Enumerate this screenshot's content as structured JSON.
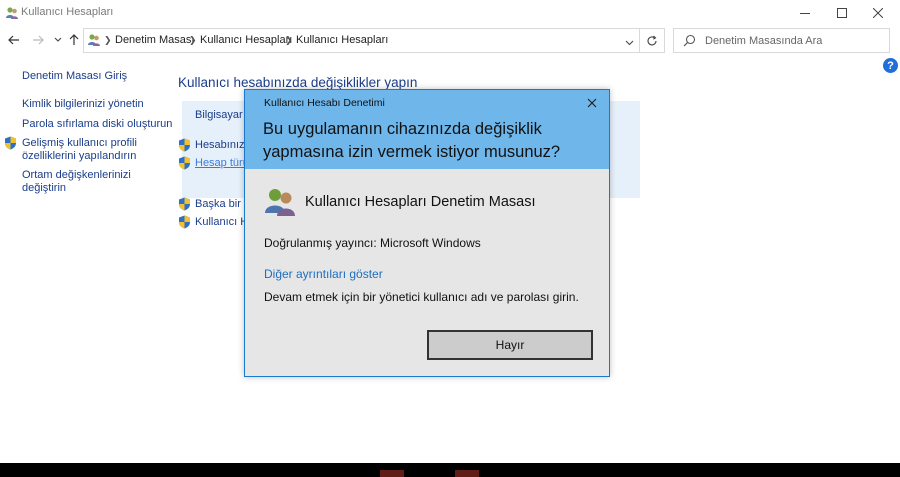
{
  "window": {
    "title": "Kullanıcı Hesapları"
  },
  "address": {
    "crumbs": [
      "Denetim Masası",
      "Kullanıcı Hesapları",
      "Kullanıcı Hesapları"
    ]
  },
  "search": {
    "placeholder": "Denetim Masasında Ara"
  },
  "help_label": "?",
  "left_pane": {
    "home": "Denetim Masası Giriş",
    "items": [
      "Kimlik bilgilerinizi yönetin",
      "Parola sıfırlama diski oluşturun",
      "Gelişmiş kullanıcı profili özelliklerini yapılandırın",
      "Ortam değişkenlerinizi değiştirin"
    ]
  },
  "main": {
    "heading": "Kullanıcı hesabınızda değişiklikler yapın",
    "links": [
      "Bilgisayar a",
      "Hesabınızın",
      "Hesap türün",
      "Başka bir he",
      "Kullanıcı He"
    ]
  },
  "uac": {
    "title": "Kullanıcı Hesabı Denetimi",
    "question": "Bu uygulamanın cihazınızda değişiklik yapmasına izin vermek istiyor musunuz?",
    "app_name": "Kullanıcı Hesapları Denetim Masası",
    "publisher": "Doğrulanmış yayıncı: Microsoft Windows",
    "details_link": "Diğer ayrıntıları göster",
    "message": "Devam etmek için bir yönetici kullanıcı adı ve parolası girin.",
    "no_button": "Hayır"
  },
  "colors": {
    "link": "#1a3d8a",
    "uac_header": "#6fb6ea",
    "uac_body": "#e6e6e6",
    "uac_link": "#1b6fc2",
    "help": "#1e6fd9"
  }
}
